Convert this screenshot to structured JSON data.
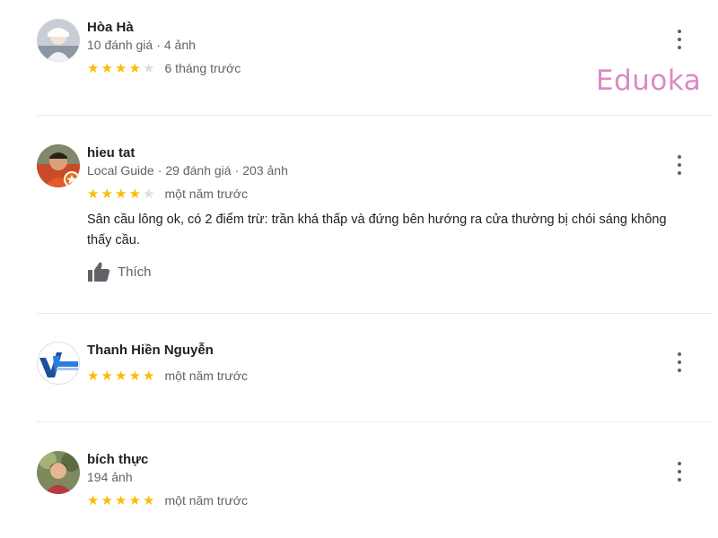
{
  "watermark": {
    "text": "Eduoka",
    "color": "#d98ac4"
  },
  "colors": {
    "star_on": "#fbbc04",
    "star_off": "#dadce0",
    "secondary_text": "#5f6368"
  },
  "reviews": [
    {
      "name": "Hòa Hà",
      "meta": [
        "10 đánh giá",
        "4 ảnh"
      ],
      "stars": 4,
      "time": "6 tháng trước",
      "avatar": "photo-avatar"
    },
    {
      "name": "hieu tat",
      "meta": [
        "Local Guide",
        "29 đánh giá",
        "203 ảnh"
      ],
      "stars": 4,
      "time": "một năm trước",
      "text": "Sân cầu lông ok, có 2 điểm trừ: trần khá thấp và đứng bên hướng ra cửa thường bị chói sáng không thấy cầu.",
      "like_label": "Thích",
      "avatar": "photo-avatar-local-guide"
    },
    {
      "name": "Thanh Hiền Nguyễn",
      "stars": 5,
      "time": "một năm trước",
      "avatar": "logo-avatar"
    },
    {
      "name": "bích thực",
      "meta": [
        "194 ảnh"
      ],
      "stars": 5,
      "time": "một năm trước",
      "avatar": "photo-avatar"
    }
  ]
}
